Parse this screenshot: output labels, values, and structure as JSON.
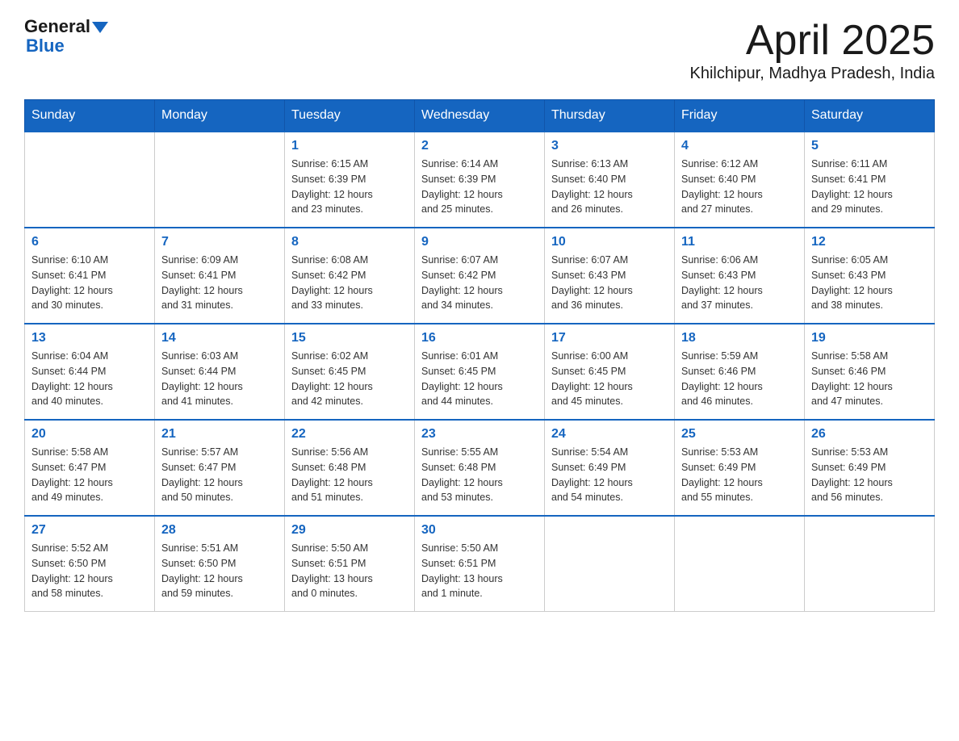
{
  "header": {
    "logo_general": "General",
    "logo_blue": "Blue",
    "month": "April 2025",
    "location": "Khilchipur, Madhya Pradesh, India"
  },
  "weekdays": [
    "Sunday",
    "Monday",
    "Tuesday",
    "Wednesday",
    "Thursday",
    "Friday",
    "Saturday"
  ],
  "weeks": [
    [
      {
        "day": "",
        "info": ""
      },
      {
        "day": "",
        "info": ""
      },
      {
        "day": "1",
        "info": "Sunrise: 6:15 AM\nSunset: 6:39 PM\nDaylight: 12 hours\nand 23 minutes."
      },
      {
        "day": "2",
        "info": "Sunrise: 6:14 AM\nSunset: 6:39 PM\nDaylight: 12 hours\nand 25 minutes."
      },
      {
        "day": "3",
        "info": "Sunrise: 6:13 AM\nSunset: 6:40 PM\nDaylight: 12 hours\nand 26 minutes."
      },
      {
        "day": "4",
        "info": "Sunrise: 6:12 AM\nSunset: 6:40 PM\nDaylight: 12 hours\nand 27 minutes."
      },
      {
        "day": "5",
        "info": "Sunrise: 6:11 AM\nSunset: 6:41 PM\nDaylight: 12 hours\nand 29 minutes."
      }
    ],
    [
      {
        "day": "6",
        "info": "Sunrise: 6:10 AM\nSunset: 6:41 PM\nDaylight: 12 hours\nand 30 minutes."
      },
      {
        "day": "7",
        "info": "Sunrise: 6:09 AM\nSunset: 6:41 PM\nDaylight: 12 hours\nand 31 minutes."
      },
      {
        "day": "8",
        "info": "Sunrise: 6:08 AM\nSunset: 6:42 PM\nDaylight: 12 hours\nand 33 minutes."
      },
      {
        "day": "9",
        "info": "Sunrise: 6:07 AM\nSunset: 6:42 PM\nDaylight: 12 hours\nand 34 minutes."
      },
      {
        "day": "10",
        "info": "Sunrise: 6:07 AM\nSunset: 6:43 PM\nDaylight: 12 hours\nand 36 minutes."
      },
      {
        "day": "11",
        "info": "Sunrise: 6:06 AM\nSunset: 6:43 PM\nDaylight: 12 hours\nand 37 minutes."
      },
      {
        "day": "12",
        "info": "Sunrise: 6:05 AM\nSunset: 6:43 PM\nDaylight: 12 hours\nand 38 minutes."
      }
    ],
    [
      {
        "day": "13",
        "info": "Sunrise: 6:04 AM\nSunset: 6:44 PM\nDaylight: 12 hours\nand 40 minutes."
      },
      {
        "day": "14",
        "info": "Sunrise: 6:03 AM\nSunset: 6:44 PM\nDaylight: 12 hours\nand 41 minutes."
      },
      {
        "day": "15",
        "info": "Sunrise: 6:02 AM\nSunset: 6:45 PM\nDaylight: 12 hours\nand 42 minutes."
      },
      {
        "day": "16",
        "info": "Sunrise: 6:01 AM\nSunset: 6:45 PM\nDaylight: 12 hours\nand 44 minutes."
      },
      {
        "day": "17",
        "info": "Sunrise: 6:00 AM\nSunset: 6:45 PM\nDaylight: 12 hours\nand 45 minutes."
      },
      {
        "day": "18",
        "info": "Sunrise: 5:59 AM\nSunset: 6:46 PM\nDaylight: 12 hours\nand 46 minutes."
      },
      {
        "day": "19",
        "info": "Sunrise: 5:58 AM\nSunset: 6:46 PM\nDaylight: 12 hours\nand 47 minutes."
      }
    ],
    [
      {
        "day": "20",
        "info": "Sunrise: 5:58 AM\nSunset: 6:47 PM\nDaylight: 12 hours\nand 49 minutes."
      },
      {
        "day": "21",
        "info": "Sunrise: 5:57 AM\nSunset: 6:47 PM\nDaylight: 12 hours\nand 50 minutes."
      },
      {
        "day": "22",
        "info": "Sunrise: 5:56 AM\nSunset: 6:48 PM\nDaylight: 12 hours\nand 51 minutes."
      },
      {
        "day": "23",
        "info": "Sunrise: 5:55 AM\nSunset: 6:48 PM\nDaylight: 12 hours\nand 53 minutes."
      },
      {
        "day": "24",
        "info": "Sunrise: 5:54 AM\nSunset: 6:49 PM\nDaylight: 12 hours\nand 54 minutes."
      },
      {
        "day": "25",
        "info": "Sunrise: 5:53 AM\nSunset: 6:49 PM\nDaylight: 12 hours\nand 55 minutes."
      },
      {
        "day": "26",
        "info": "Sunrise: 5:53 AM\nSunset: 6:49 PM\nDaylight: 12 hours\nand 56 minutes."
      }
    ],
    [
      {
        "day": "27",
        "info": "Sunrise: 5:52 AM\nSunset: 6:50 PM\nDaylight: 12 hours\nand 58 minutes."
      },
      {
        "day": "28",
        "info": "Sunrise: 5:51 AM\nSunset: 6:50 PM\nDaylight: 12 hours\nand 59 minutes."
      },
      {
        "day": "29",
        "info": "Sunrise: 5:50 AM\nSunset: 6:51 PM\nDaylight: 13 hours\nand 0 minutes."
      },
      {
        "day": "30",
        "info": "Sunrise: 5:50 AM\nSunset: 6:51 PM\nDaylight: 13 hours\nand 1 minute."
      },
      {
        "day": "",
        "info": ""
      },
      {
        "day": "",
        "info": ""
      },
      {
        "day": "",
        "info": ""
      }
    ]
  ]
}
